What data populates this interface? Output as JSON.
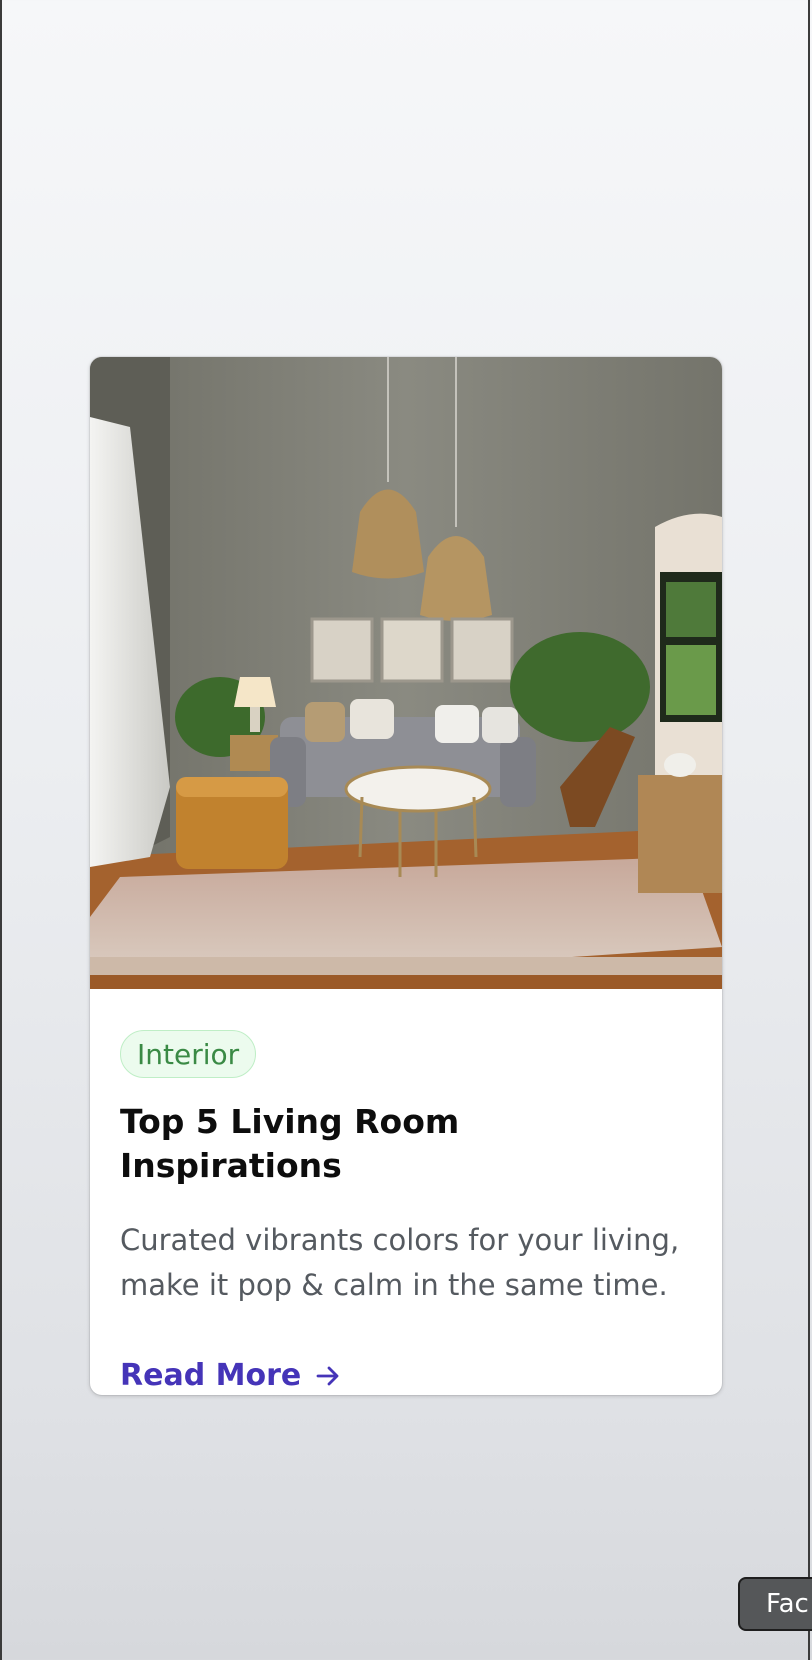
{
  "card": {
    "tag": "Interior",
    "title": "Top 5 Living Room Inspirations",
    "description": "Curated vibrants colors for your living, make it pop & calm in the same time.",
    "cta_label": "Read More",
    "cta_icon": "arrow-right-icon",
    "image_subject": "living-room-photo"
  },
  "floating_button": {
    "label": "Fac"
  },
  "colors": {
    "accent": "#4534b8",
    "tag_bg": "#ecfbee",
    "tag_text": "#3a8a45",
    "title": "#0d0d0d",
    "body_text": "#555a60"
  }
}
